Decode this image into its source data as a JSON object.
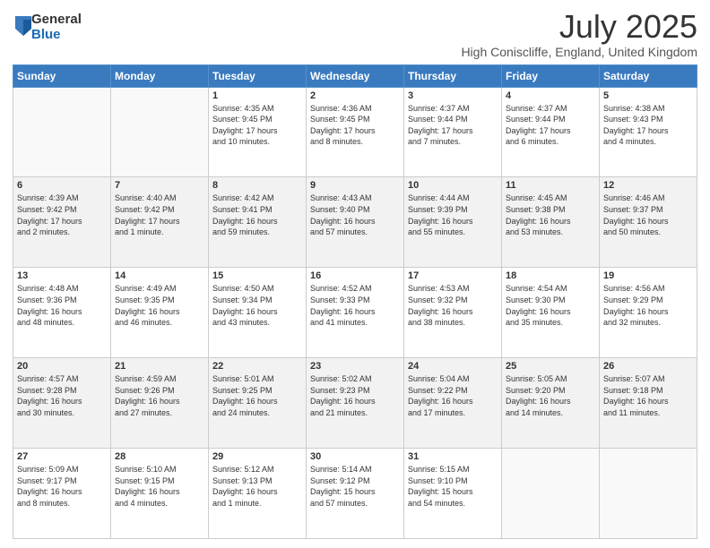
{
  "logo": {
    "general": "General",
    "blue": "Blue"
  },
  "title": "July 2025",
  "location": "High Coniscliffe, England, United Kingdom",
  "days_of_week": [
    "Sunday",
    "Monday",
    "Tuesday",
    "Wednesday",
    "Thursday",
    "Friday",
    "Saturday"
  ],
  "weeks": [
    [
      {
        "day": "",
        "info": ""
      },
      {
        "day": "",
        "info": ""
      },
      {
        "day": "1",
        "info": "Sunrise: 4:35 AM\nSunset: 9:45 PM\nDaylight: 17 hours\nand 10 minutes."
      },
      {
        "day": "2",
        "info": "Sunrise: 4:36 AM\nSunset: 9:45 PM\nDaylight: 17 hours\nand 8 minutes."
      },
      {
        "day": "3",
        "info": "Sunrise: 4:37 AM\nSunset: 9:44 PM\nDaylight: 17 hours\nand 7 minutes."
      },
      {
        "day": "4",
        "info": "Sunrise: 4:37 AM\nSunset: 9:44 PM\nDaylight: 17 hours\nand 6 minutes."
      },
      {
        "day": "5",
        "info": "Sunrise: 4:38 AM\nSunset: 9:43 PM\nDaylight: 17 hours\nand 4 minutes."
      }
    ],
    [
      {
        "day": "6",
        "info": "Sunrise: 4:39 AM\nSunset: 9:42 PM\nDaylight: 17 hours\nand 2 minutes."
      },
      {
        "day": "7",
        "info": "Sunrise: 4:40 AM\nSunset: 9:42 PM\nDaylight: 17 hours\nand 1 minute."
      },
      {
        "day": "8",
        "info": "Sunrise: 4:42 AM\nSunset: 9:41 PM\nDaylight: 16 hours\nand 59 minutes."
      },
      {
        "day": "9",
        "info": "Sunrise: 4:43 AM\nSunset: 9:40 PM\nDaylight: 16 hours\nand 57 minutes."
      },
      {
        "day": "10",
        "info": "Sunrise: 4:44 AM\nSunset: 9:39 PM\nDaylight: 16 hours\nand 55 minutes."
      },
      {
        "day": "11",
        "info": "Sunrise: 4:45 AM\nSunset: 9:38 PM\nDaylight: 16 hours\nand 53 minutes."
      },
      {
        "day": "12",
        "info": "Sunrise: 4:46 AM\nSunset: 9:37 PM\nDaylight: 16 hours\nand 50 minutes."
      }
    ],
    [
      {
        "day": "13",
        "info": "Sunrise: 4:48 AM\nSunset: 9:36 PM\nDaylight: 16 hours\nand 48 minutes."
      },
      {
        "day": "14",
        "info": "Sunrise: 4:49 AM\nSunset: 9:35 PM\nDaylight: 16 hours\nand 46 minutes."
      },
      {
        "day": "15",
        "info": "Sunrise: 4:50 AM\nSunset: 9:34 PM\nDaylight: 16 hours\nand 43 minutes."
      },
      {
        "day": "16",
        "info": "Sunrise: 4:52 AM\nSunset: 9:33 PM\nDaylight: 16 hours\nand 41 minutes."
      },
      {
        "day": "17",
        "info": "Sunrise: 4:53 AM\nSunset: 9:32 PM\nDaylight: 16 hours\nand 38 minutes."
      },
      {
        "day": "18",
        "info": "Sunrise: 4:54 AM\nSunset: 9:30 PM\nDaylight: 16 hours\nand 35 minutes."
      },
      {
        "day": "19",
        "info": "Sunrise: 4:56 AM\nSunset: 9:29 PM\nDaylight: 16 hours\nand 32 minutes."
      }
    ],
    [
      {
        "day": "20",
        "info": "Sunrise: 4:57 AM\nSunset: 9:28 PM\nDaylight: 16 hours\nand 30 minutes."
      },
      {
        "day": "21",
        "info": "Sunrise: 4:59 AM\nSunset: 9:26 PM\nDaylight: 16 hours\nand 27 minutes."
      },
      {
        "day": "22",
        "info": "Sunrise: 5:01 AM\nSunset: 9:25 PM\nDaylight: 16 hours\nand 24 minutes."
      },
      {
        "day": "23",
        "info": "Sunrise: 5:02 AM\nSunset: 9:23 PM\nDaylight: 16 hours\nand 21 minutes."
      },
      {
        "day": "24",
        "info": "Sunrise: 5:04 AM\nSunset: 9:22 PM\nDaylight: 16 hours\nand 17 minutes."
      },
      {
        "day": "25",
        "info": "Sunrise: 5:05 AM\nSunset: 9:20 PM\nDaylight: 16 hours\nand 14 minutes."
      },
      {
        "day": "26",
        "info": "Sunrise: 5:07 AM\nSunset: 9:18 PM\nDaylight: 16 hours\nand 11 minutes."
      }
    ],
    [
      {
        "day": "27",
        "info": "Sunrise: 5:09 AM\nSunset: 9:17 PM\nDaylight: 16 hours\nand 8 minutes."
      },
      {
        "day": "28",
        "info": "Sunrise: 5:10 AM\nSunset: 9:15 PM\nDaylight: 16 hours\nand 4 minutes."
      },
      {
        "day": "29",
        "info": "Sunrise: 5:12 AM\nSunset: 9:13 PM\nDaylight: 16 hours\nand 1 minute."
      },
      {
        "day": "30",
        "info": "Sunrise: 5:14 AM\nSunset: 9:12 PM\nDaylight: 15 hours\nand 57 minutes."
      },
      {
        "day": "31",
        "info": "Sunrise: 5:15 AM\nSunset: 9:10 PM\nDaylight: 15 hours\nand 54 minutes."
      },
      {
        "day": "",
        "info": ""
      },
      {
        "day": "",
        "info": ""
      }
    ]
  ]
}
